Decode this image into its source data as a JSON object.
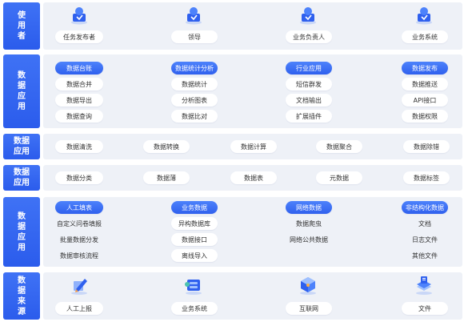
{
  "row_labels": {
    "users": [
      "使",
      "用",
      "者"
    ],
    "data_app": [
      "数",
      "据",
      "应",
      "用"
    ],
    "cleaning": [
      "数据",
      "应用"
    ],
    "catalog": [
      "数据",
      "应用"
    ],
    "collection": [
      "数",
      "据",
      "应",
      "用"
    ],
    "sources": [
      "数",
      "据",
      "来",
      "源"
    ]
  },
  "users": [
    "任务发布者",
    "领导",
    "业务负责人",
    "业务系统"
  ],
  "data_app": [
    {
      "header": "数据台账",
      "items": [
        "数据合并",
        "数据导出",
        "数据查询"
      ]
    },
    {
      "header": "数据统计分析",
      "items": [
        "数据统计",
        "分析图表",
        "数据比对"
      ]
    },
    {
      "header": "行业应用",
      "items": [
        "短信群发",
        "文档输出",
        "扩展插件"
      ]
    },
    {
      "header": "数据发布",
      "items": [
        "数据推送",
        "API接口",
        "数据权限"
      ]
    }
  ],
  "cleaning": [
    "数据清洗",
    "数据转换",
    "数据计算",
    "数据聚合",
    "数据除错"
  ],
  "catalog": [
    "数据分类",
    "数据薄",
    "数据表",
    "元数据",
    "数据标签"
  ],
  "collection": [
    {
      "header": "人工填表",
      "items": [
        "自定义问卷填报",
        "批量数据分发",
        "数据审核流程"
      ]
    },
    {
      "header": "业务数据",
      "items": [
        "异构数据库",
        "数据接口",
        "离线导入"
      ]
    },
    {
      "header": "网络数据",
      "items": [
        "数据爬虫",
        "网络公共数据",
        ""
      ]
    },
    {
      "header": "非结构化数据",
      "items": [
        "文档",
        "日志文件",
        "其他文件"
      ]
    }
  ],
  "sources": [
    "人工上报",
    "业务系统",
    "互联网",
    "文件"
  ],
  "icons": {
    "users": "user-badge-icon",
    "sources": [
      "pen-edit-icon",
      "server-icon",
      "cube-network-icon",
      "file-stack-icon"
    ]
  },
  "colors": {
    "accent": "#2f60ee",
    "panel": "#eef1f7"
  }
}
